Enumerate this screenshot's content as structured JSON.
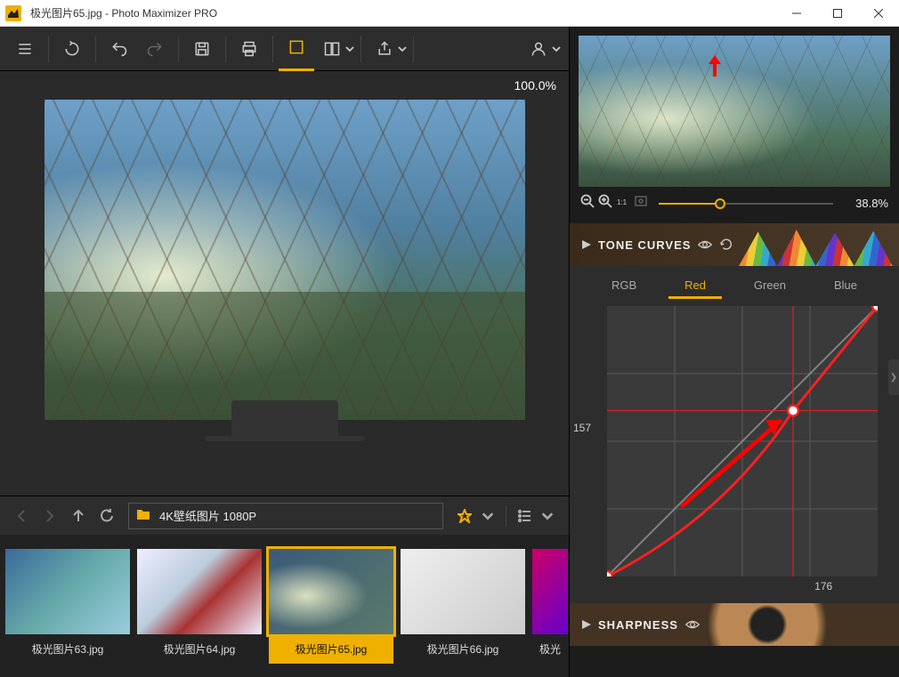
{
  "window": {
    "title": "极光图片65.jpg - Photo Maximizer PRO"
  },
  "toolbar": {
    "zoom_label": "100.0%"
  },
  "browser": {
    "folder_label": "4K壁纸图片 1080P"
  },
  "thumbnails": [
    {
      "caption": "极光图片63.jpg"
    },
    {
      "caption": "极光图片64.jpg"
    },
    {
      "caption": "极光图片65.jpg"
    },
    {
      "caption": "极光图片66.jpg"
    },
    {
      "caption": "极光"
    }
  ],
  "navigator": {
    "zoom_pct": "38.8%"
  },
  "panels": {
    "tone_curves": {
      "title": "TONE CURVES",
      "channels": {
        "rgb": "RGB",
        "red": "Red",
        "green": "Green",
        "blue": "Blue"
      },
      "point": {
        "x": "176",
        "y": "157"
      }
    },
    "sharpness": {
      "title": "SHARPNESS"
    }
  }
}
